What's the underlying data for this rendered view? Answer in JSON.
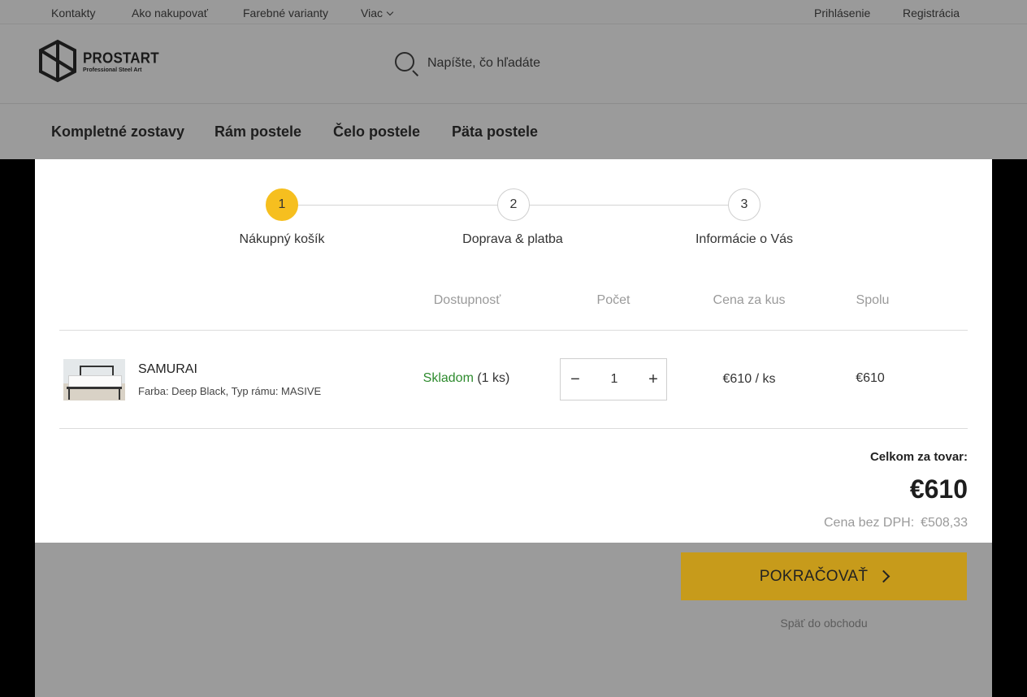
{
  "topbar": {
    "links": [
      "Kontakty",
      "Ako nakupovať",
      "Farebné varianty",
      "Viac"
    ],
    "login": "Prihlásenie",
    "register": "Registrácia"
  },
  "brand": {
    "name": "PROSTART",
    "tagline": "Professional Steel Art"
  },
  "search": {
    "placeholder": "Napíšte, čo hľadáte"
  },
  "nav": {
    "items": [
      "Kompletné zostavy",
      "Rám postele",
      "Čelo postele",
      "Päta postele"
    ]
  },
  "steps": [
    {
      "num": "1",
      "label": "Nákupný košík"
    },
    {
      "num": "2",
      "label": "Doprava & platba"
    },
    {
      "num": "3",
      "label": "Informácie o Vás"
    }
  ],
  "table": {
    "headers": {
      "availability": "Dostupnosť",
      "count": "Počet",
      "unit_price": "Cena za kus",
      "total": "Spolu"
    },
    "item": {
      "name": "SAMURAI",
      "variant": "Farba: Deep Black, Typ rámu: MASIVE",
      "stock_status": "Skladom",
      "stock_count": "(1 ks)",
      "quantity": "1",
      "unit_price": "€610 / ks",
      "total": "€610"
    }
  },
  "summary": {
    "label": "Celkom za tovar:",
    "total": "€610",
    "net_label": "Cena bez DPH:",
    "net_value": "€508,33"
  },
  "actions": {
    "continue": "POKRAČOVAŤ",
    "back": "Späť do obchodu"
  },
  "colors": {
    "accent": "#f6bf1f",
    "cta": "#c79b1b",
    "in_stock": "#2e8b2e"
  }
}
